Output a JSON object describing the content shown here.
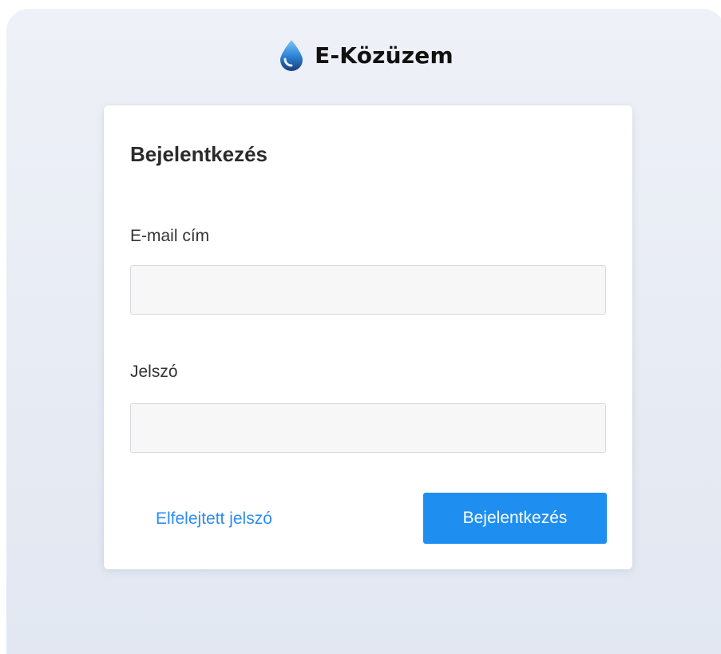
{
  "brand": {
    "name": "E-Közüzem",
    "icon": "water-drop-icon",
    "icon_colors": [
      "#5fb6ee",
      "#1f6fc4",
      "#163d7a"
    ]
  },
  "login": {
    "title": "Bejelentkezés",
    "email_label": "E-mail cím",
    "email_value": "",
    "password_label": "Jelszó",
    "password_value": "",
    "forgot_link": "Elfelejtett jelszó",
    "submit_label": "Bejelentkezés"
  },
  "colors": {
    "accent": "#1e8ff0",
    "link": "#2f8cf0",
    "background": "#e8ecf4",
    "input_background": "#f7f7f7"
  }
}
